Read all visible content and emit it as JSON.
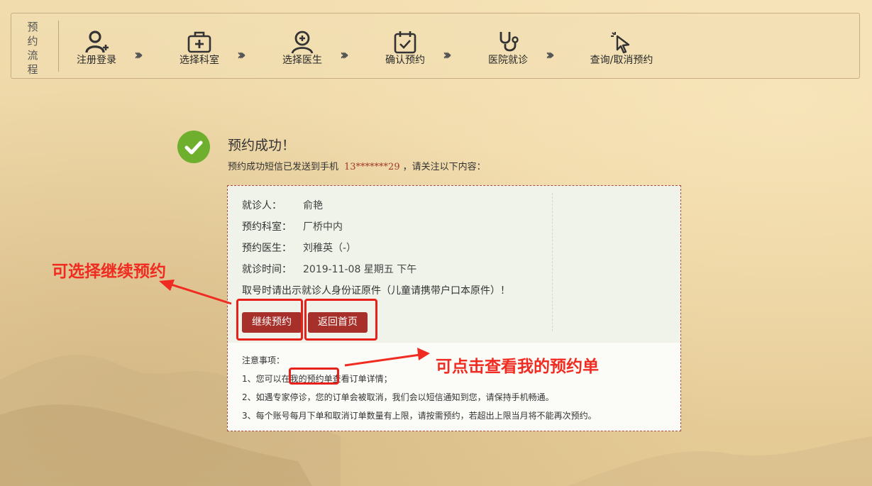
{
  "steps": {
    "label": [
      "预",
      "约",
      "流",
      "程"
    ],
    "items": [
      {
        "label": "注册登录",
        "icon": "user-plus-icon"
      },
      {
        "label": "选择科室",
        "icon": "medical-kit-icon"
      },
      {
        "label": "选择医生",
        "icon": "doctor-icon"
      },
      {
        "label": "确认预约",
        "icon": "calendar-check-icon"
      },
      {
        "label": "医院就诊",
        "icon": "stethoscope-icon"
      },
      {
        "label": "查询/取消预约",
        "icon": "cursor-click-icon"
      }
    ],
    "separator": "›››"
  },
  "success": {
    "title": "预约成功！",
    "msg_prefix": "预约成功短信已发送到手机",
    "phone": "13*******29",
    "msg_suffix": "，请关注以下内容："
  },
  "details": {
    "patient_label": "就诊人：",
    "patient_value": "俞艳",
    "dept_label": "预约科室：",
    "dept_value": "厂桥中内",
    "doctor_label": "预约医生：",
    "doctor_value": "刘稚英（-）",
    "time_label": "就诊时间：",
    "time_value": "2019-11-08  星期五  下午",
    "reminder": "取号时请出示就诊人身份证原件（儿童请携带户口本原件）！"
  },
  "buttons": {
    "continue": "继续预约",
    "home": "返回首页"
  },
  "notes": {
    "title": "注意事项：",
    "line1_prefix": "1、您可以在",
    "line1_link": "我的预约单",
    "line1_suffix": "查看订单详情；",
    "line2": "2、如遇专家停诊，您的订单会被取消，我们会以短信通知到您，请保持手机畅通。",
    "line3": "3、每个账号每月下单和取消订单数量有上限，请按需预约，若超出上限当月将不能再次预约。"
  },
  "annotations": {
    "left": "可选择继续预约",
    "right": "可点击查看我的预约单"
  },
  "colors": {
    "accent": "#a7302a",
    "success": "#6eaf2d",
    "annotation": "#f02b21"
  }
}
